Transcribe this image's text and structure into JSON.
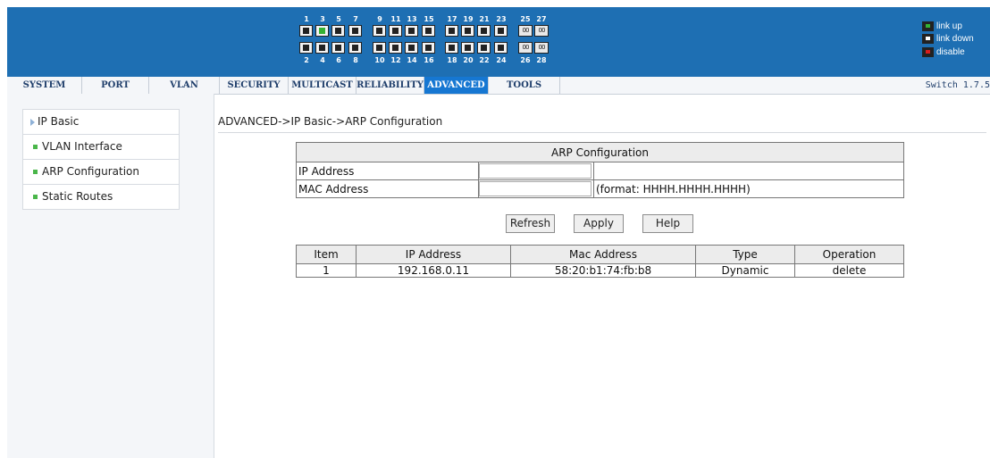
{
  "header": {
    "ports_top": [
      "1",
      "3",
      "5",
      "7",
      "9",
      "11",
      "13",
      "15",
      "17",
      "19",
      "21",
      "23",
      "25",
      "27"
    ],
    "ports_bottom": [
      "2",
      "4",
      "6",
      "8",
      "10",
      "12",
      "14",
      "16",
      "18",
      "20",
      "22",
      "24",
      "26",
      "28"
    ],
    "port_up": "3",
    "sfp_label": "00",
    "legend": {
      "link_up": "link up",
      "link_down": "link down",
      "disable": "disable"
    },
    "colors": {
      "banner": "#1e6fb3",
      "link_up": "#34b233",
      "link_down": "#222222",
      "disable": "#d81e1e"
    }
  },
  "nav": {
    "tabs": [
      "SYSTEM",
      "PORT",
      "VLAN",
      "SECURITY",
      "MULTICAST",
      "RELIABILITY",
      "ADVANCED",
      "TOOLS"
    ],
    "active": "ADVANCED",
    "version": "Switch 1.7.5"
  },
  "sidebar": {
    "items": [
      {
        "label": "IP Basic"
      },
      {
        "label": "VLAN Interface"
      },
      {
        "label": "ARP Configuration"
      },
      {
        "label": "Static Routes"
      }
    ]
  },
  "main": {
    "breadcrumb": "ADVANCED->IP Basic->ARP Configuration",
    "form": {
      "title": "ARP Configuration",
      "ip_label": "IP Address",
      "ip_value": "",
      "mac_label": "MAC Address",
      "mac_value": "",
      "mac_hint": "(format: HHHH.HHHH.HHHH)"
    },
    "buttons": {
      "refresh": "Refresh",
      "apply": "Apply",
      "help": "Help"
    },
    "table": {
      "headers": [
        "Item",
        "IP Address",
        "Mac Address",
        "Type",
        "Operation"
      ],
      "rows": [
        {
          "item": "1",
          "ip": "192.168.0.11",
          "mac": "58:20:b1:74:fb:b8",
          "type": "Dynamic",
          "operation": "delete"
        }
      ]
    }
  }
}
